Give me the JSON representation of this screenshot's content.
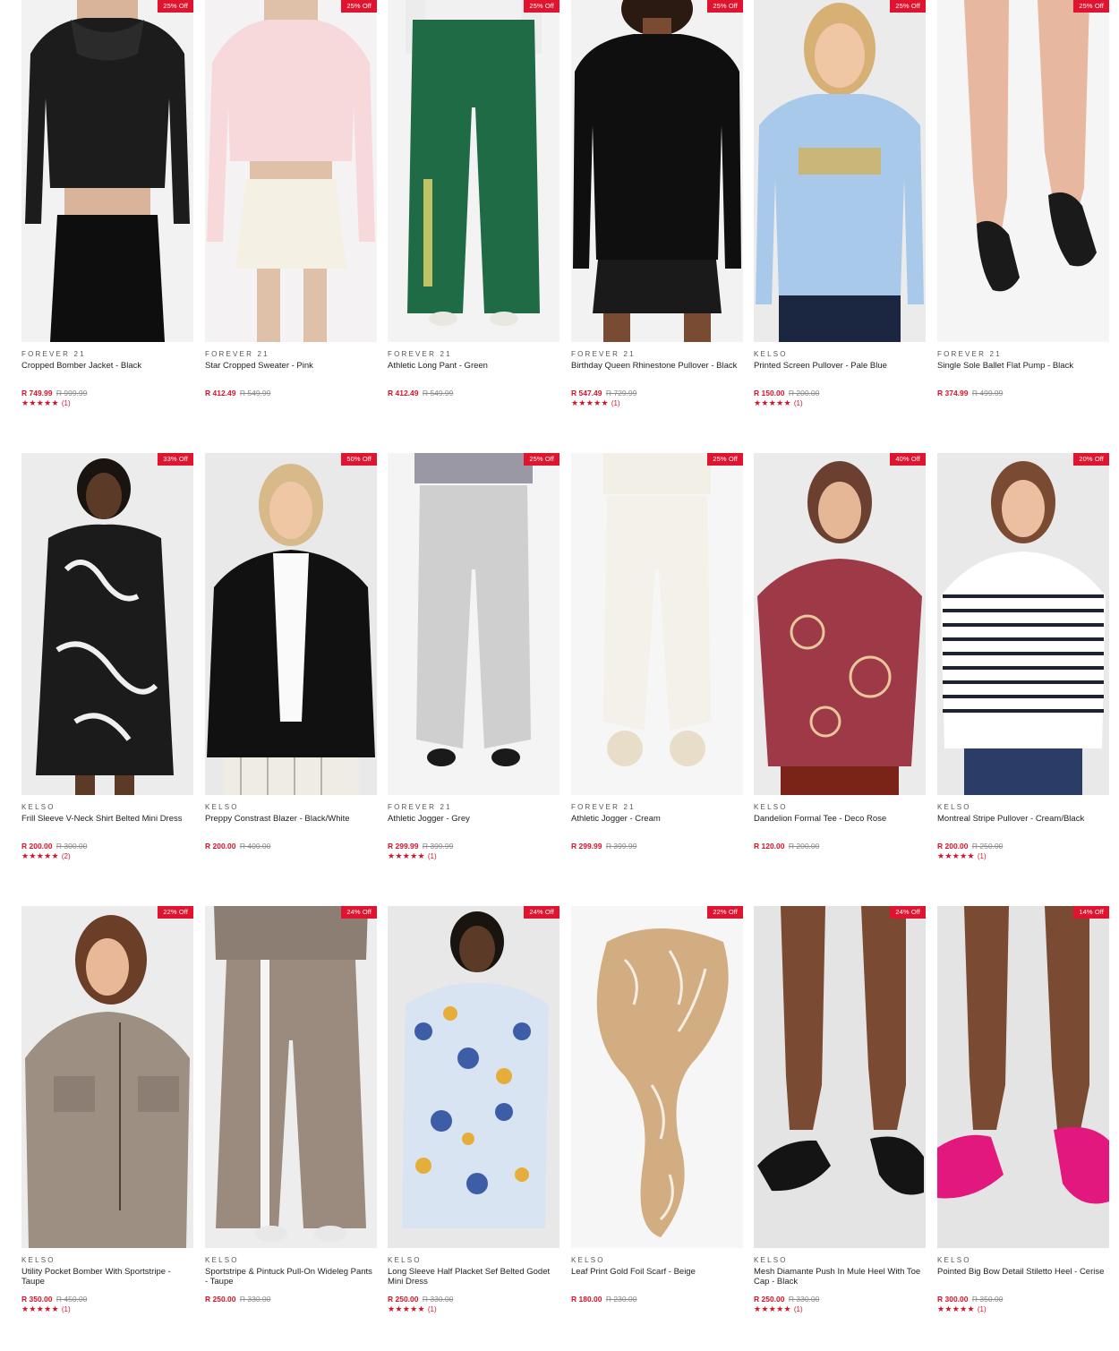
{
  "colors": {
    "sale": "#d5132a",
    "badge": "#e0142f",
    "text": "#1f1f1f",
    "muted": "#8a8a8a"
  },
  "products": [
    {
      "brand": "FOREVER 21",
      "name": "Cropped Bomber Jacket - Black",
      "price": "R 749.99",
      "was": "R 999.99",
      "badge": "25% Off",
      "stars": "★★★★★",
      "count": "(1)"
    },
    {
      "brand": "FOREVER 21",
      "name": "Star Cropped Sweater - Pink",
      "price": "R 412.49",
      "was": "R 549.99",
      "badge": "25% Off",
      "stars": "",
      "count": ""
    },
    {
      "brand": "FOREVER 21",
      "name": "Athletic Long Pant - Green",
      "price": "R 412.49",
      "was": "R 549.99",
      "badge": "25% Off",
      "stars": "",
      "count": ""
    },
    {
      "brand": "FOREVER 21",
      "name": "Birthday Queen Rhinestone Pullover - Black",
      "price": "R 547.49",
      "was": "R 729.99",
      "badge": "25% Off",
      "stars": "★★★★★",
      "count": "(1)"
    },
    {
      "brand": "KELSO",
      "name": "Printed Screen Pullover - Pale Blue",
      "price": "R 150.00",
      "was": "R 200.00",
      "badge": "25% Off",
      "stars": "★★★★★",
      "count": "(1)"
    },
    {
      "brand": "FOREVER 21",
      "name": "Single Sole Ballet Flat Pump - Black",
      "price": "R 374.99",
      "was": "R 499.99",
      "badge": "25% Off",
      "stars": "",
      "count": ""
    },
    {
      "brand": "KELSO",
      "name": "Frill Sleeve V-Neck Shirt Belted Mini Dress",
      "price": "R 200.00",
      "was": "R 300.00",
      "badge": "33% Off",
      "stars": "★★★★★",
      "count": "(2)"
    },
    {
      "brand": "KELSO",
      "name": "Preppy Constrast Blazer - Black/White",
      "price": "R 200.00",
      "was": "R 400.00",
      "badge": "50% Off",
      "stars": "",
      "count": ""
    },
    {
      "brand": "FOREVER 21",
      "name": "Athletic Jogger - Grey",
      "price": "R 299.99",
      "was": "R 399.99",
      "badge": "25% Off",
      "stars": "★★★★★",
      "count": "(1)"
    },
    {
      "brand": "FOREVER 21",
      "name": "Athletic Jogger - Cream",
      "price": "R 299.99",
      "was": "R 399.99",
      "badge": "25% Off",
      "stars": "",
      "count": ""
    },
    {
      "brand": "KELSO",
      "name": "Dandelion Formal Tee - Deco Rose",
      "price": "R 120.00",
      "was": "R 200.00",
      "badge": "40% Off",
      "stars": "",
      "count": ""
    },
    {
      "brand": "KELSO",
      "name": "Montreal Stripe Pullover - Cream/Black",
      "price": "R 200.00",
      "was": "R 250.00",
      "badge": "20% Off",
      "stars": "★★★★★",
      "count": "(1)"
    },
    {
      "brand": "KELSO",
      "name": "Utility Pocket Bomber With Sportstripe - Taupe",
      "price": "R 350.00",
      "was": "R 450.00",
      "badge": "22% Off",
      "stars": "★★★★★",
      "count": "(1)"
    },
    {
      "brand": "KELSO",
      "name": "Sportstripe & Pintuck Pull-On Wideleg Pants - Taupe",
      "price": "R 250.00",
      "was": "R 330.00",
      "badge": "24% Off",
      "stars": "",
      "count": ""
    },
    {
      "brand": "KELSO",
      "name": "Long Sleeve Half Placket Sef Belted Godet Mini Dress",
      "price": "R 250.00",
      "was": "R 330.00",
      "badge": "24% Off",
      "stars": "★★★★★",
      "count": "(1)"
    },
    {
      "brand": "KELSO",
      "name": "Leaf Print Gold Foil Scarf - Beige",
      "price": "R 180.00",
      "was": "R 230.00",
      "badge": "22% Off",
      "stars": "",
      "count": ""
    },
    {
      "brand": "KELSO",
      "name": "Mesh Diamante Push In Mule Heel With Toe Cap - Black",
      "price": "R 250.00",
      "was": "R 330.00",
      "badge": "24% Off",
      "stars": "★★★★★",
      "count": "(1)"
    },
    {
      "brand": "KELSO",
      "name": "Pointed Big Bow Detail Stiletto Heel - Cerise",
      "price": "R 300.00",
      "was": "R 350.00",
      "badge": "14% Off",
      "stars": "★★★★★",
      "count": "(1)"
    }
  ]
}
